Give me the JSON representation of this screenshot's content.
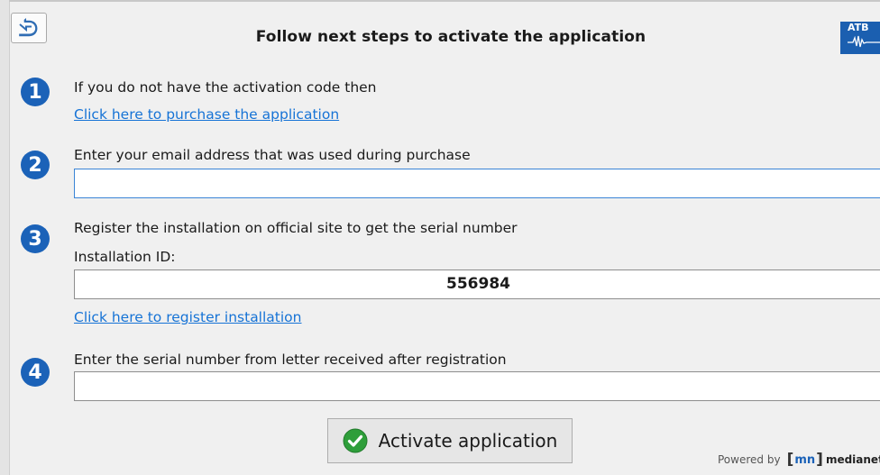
{
  "header": {
    "title": "Follow next steps to activate the application",
    "logo_text": "ATB"
  },
  "steps": [
    {
      "number": "1",
      "text": "If you do not have the activation code then",
      "link": "Click here to purchase the application"
    },
    {
      "number": "2",
      "text": "Enter your email address that was used during purchase",
      "email_value": ""
    },
    {
      "number": "3",
      "text": "Register the installation on official site to get the serial number",
      "id_label": "Installation ID:",
      "installation_id": "556984",
      "link": "Click here to register installation"
    },
    {
      "number": "4",
      "text": "Enter the serial number from letter received after registration",
      "serial_value": ""
    }
  ],
  "footer": {
    "activate_label": "Activate application",
    "powered_by": "Powered by",
    "brand_short": "mn",
    "brand_name": "medianet"
  },
  "colors": {
    "accent": "#1b62b8",
    "link": "#1673d6",
    "success": "#2e9e3a"
  }
}
